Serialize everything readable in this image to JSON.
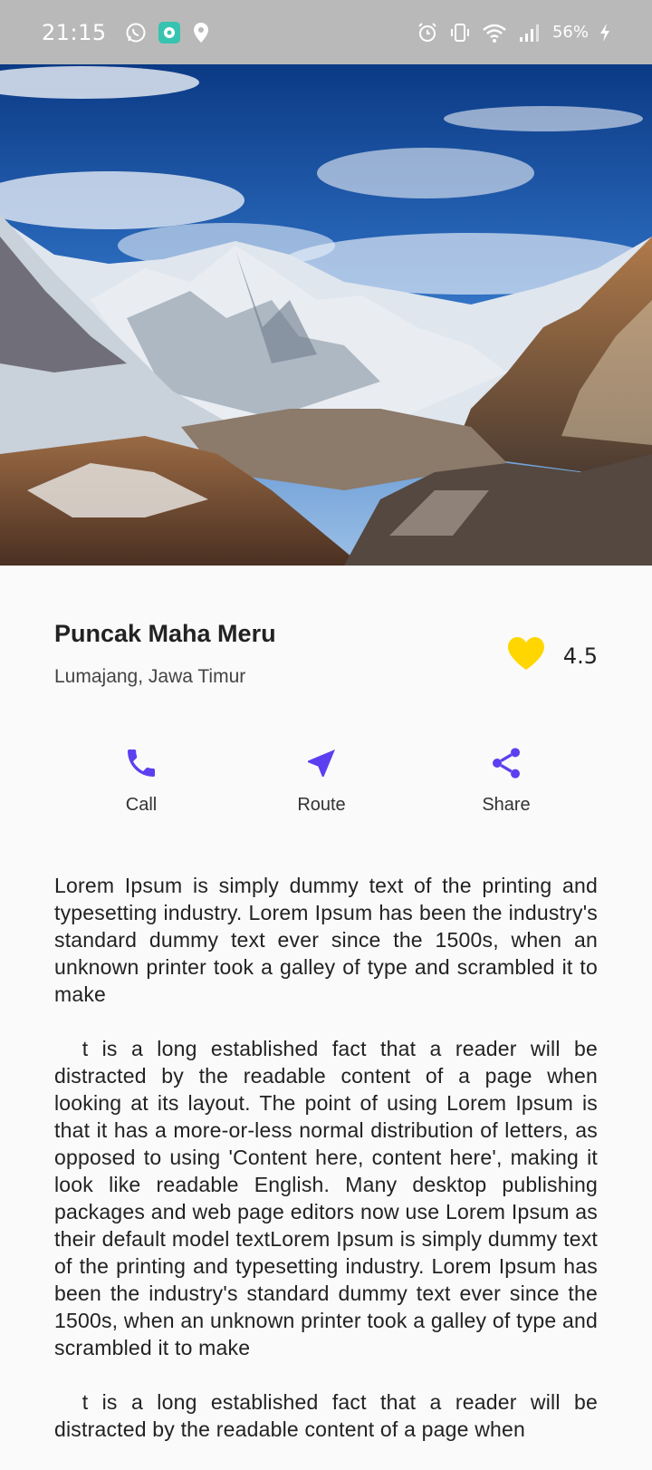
{
  "status_bar": {
    "time": "21:15",
    "battery": "56%",
    "left_icons": [
      "whatsapp-icon",
      "messenger-icon",
      "location-pin-icon"
    ],
    "right_icons": [
      "alarm-icon",
      "vibrate-icon",
      "wifi-icon",
      "signal-icon",
      "charging-icon"
    ]
  },
  "hero": {
    "image": "mountain-landscape-photo"
  },
  "place": {
    "title": "Puncak Maha Meru",
    "location": "Lumajang, Jawa Timur"
  },
  "rating": {
    "icon": "heart-icon",
    "value": "4.5",
    "color": "#FFD600"
  },
  "actions": [
    {
      "label": "Call",
      "icon": "phone-icon"
    },
    {
      "label": "Route",
      "icon": "navigation-arrow-icon"
    },
    {
      "label": "Share",
      "icon": "share-icon"
    }
  ],
  "accent_color": "#5B3FF0",
  "description": [
    "Lorem Ipsum is simply dummy text of the printing and typesetting industry. Lorem Ipsum has been the industry's standard dummy text ever since the 1500s, when an unknown printer took a galley of type and scrambled it to make",
    "  t is a long established fact that a reader will be distracted by the readable content of a page when looking at its layout. The point of using Lorem Ipsum is that it has a more-or-less normal distribution of letters, as opposed to using 'Content here, content here', making it look like readable English. Many desktop publishing packages and web page editors now use Lorem Ipsum as their default model textLorem Ipsum is simply dummy text of the printing and typesetting industry. Lorem Ipsum has been the industry's standard dummy text ever since the 1500s, when an unknown printer took a galley of type and scrambled it to make",
    "  t is a long established fact that a reader will be distracted by the readable content of a page when"
  ]
}
